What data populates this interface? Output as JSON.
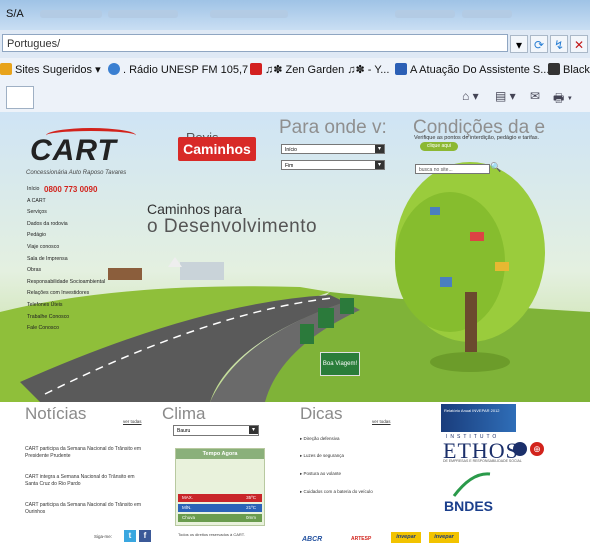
{
  "window": {
    "title": "S/A",
    "blurred_title": "Intranet - Portal de Comunicação - Microsoft PowerPoint"
  },
  "addressbar": {
    "url": "Portugues/",
    "buttons": [
      "▾",
      "⟳",
      "↯",
      "✕",
      "🔍"
    ]
  },
  "favorites": {
    "items": [
      {
        "label": "Sites Sugeridos ▾",
        "icon": "favorites-icon",
        "color": "#e8a31b"
      },
      {
        "label": ". Rádio UNESP FM 105,7 ...",
        "icon": "ie-icon",
        "color": "#3a7fd1"
      },
      {
        "label": "♫✽ Zen Garden ♫✽ - Y...",
        "icon": "youtube-icon",
        "color": "#d32020"
      },
      {
        "label": "A Atuação Do Assistente S...",
        "icon": "word-icon",
        "color": "#2b5fb5"
      },
      {
        "label": "Blackb",
        "icon": "blackboard-icon",
        "color": "#333333"
      }
    ]
  },
  "commandbar": {
    "items": [
      "⌂ ▾",
      "▤ ▾",
      "✉",
      "🖶 ▾"
    ]
  },
  "site": {
    "logo": {
      "brand": "CART",
      "subtitle": "Concessionária Auto Raposo Tavares",
      "phone": "0800 773 0090"
    },
    "revista": {
      "label": "Revis",
      "badge": "Caminhos"
    },
    "route_widget": {
      "title": "Para onde v:",
      "origin_placeholder": "Início",
      "destination_placeholder": "Fim"
    },
    "conditions": {
      "title": "Condições da e",
      "subtitle": "Verifique as pontos de interdição, pedágio e tarifas.",
      "cta": "clique aqui"
    },
    "search": {
      "placeholder": "busca no site..."
    },
    "nav": [
      "Início",
      "A CART",
      "Serviços",
      "Dados da rodovia",
      "Pedágio",
      "Viaje conosco",
      "Sala de Imprensa",
      "Obras",
      "Responsabilidade Socioambiental",
      "Relações com Investidores",
      "Telefones Úteis",
      "Trabalhe Conosco",
      "Fale Conosco"
    ],
    "tagline": {
      "line1": "Caminhos para",
      "line2": "o Desenvolvimento"
    },
    "road_sign": "Boa Viagem!",
    "noticias": {
      "title": "Notícias",
      "ver_todas": "ver todas",
      "items": [
        "CART participa da Semana Nacional do Trânsito em Presidente Prudente",
        "CART integra a Semana Nacional do Trânsito em Santa Cruz do Rio Pardo",
        "CART participa da Semana Nacional do Trânsito em Ourinhos"
      ]
    },
    "clima": {
      "title": "Clima",
      "city": "Bauru",
      "tempo_title": "Tempo Agora",
      "rows": [
        {
          "label": "MAX.",
          "value": "35ºC",
          "color": "#c9262a"
        },
        {
          "label": "MÍN.",
          "value": "21ºC",
          "color": "#2b63b8"
        },
        {
          "label": "Chuva",
          "value": "0mm",
          "color": "#6a9c4e"
        }
      ]
    },
    "dicas": {
      "title": "Dicas",
      "ver_todas": "ver todas",
      "items": [
        "▸ Direção defensiva",
        "▸ Luzes de segurança",
        "▸ Postura ao volante",
        "▸ Cuidados com a bateria do veículo"
      ]
    },
    "partners": {
      "relatorio": "Relatório Anual INVEPAR 2012",
      "ethos_institute": "INSTITUTO",
      "ethos": "ETHOS",
      "ethos_sub": "DE EMPRESAS E RESPONSABILIDADE SOCIAL",
      "bndes": "BNDES"
    },
    "footer": {
      "siga_me": "Siga-me:",
      "twitter": "t",
      "facebook": "f",
      "direitos": "Todos os direitos reservados à CART.",
      "abcr": "ABCR",
      "arteris": "ARTESP",
      "invepar1": "invepar",
      "invepar2": "invepar"
    }
  }
}
